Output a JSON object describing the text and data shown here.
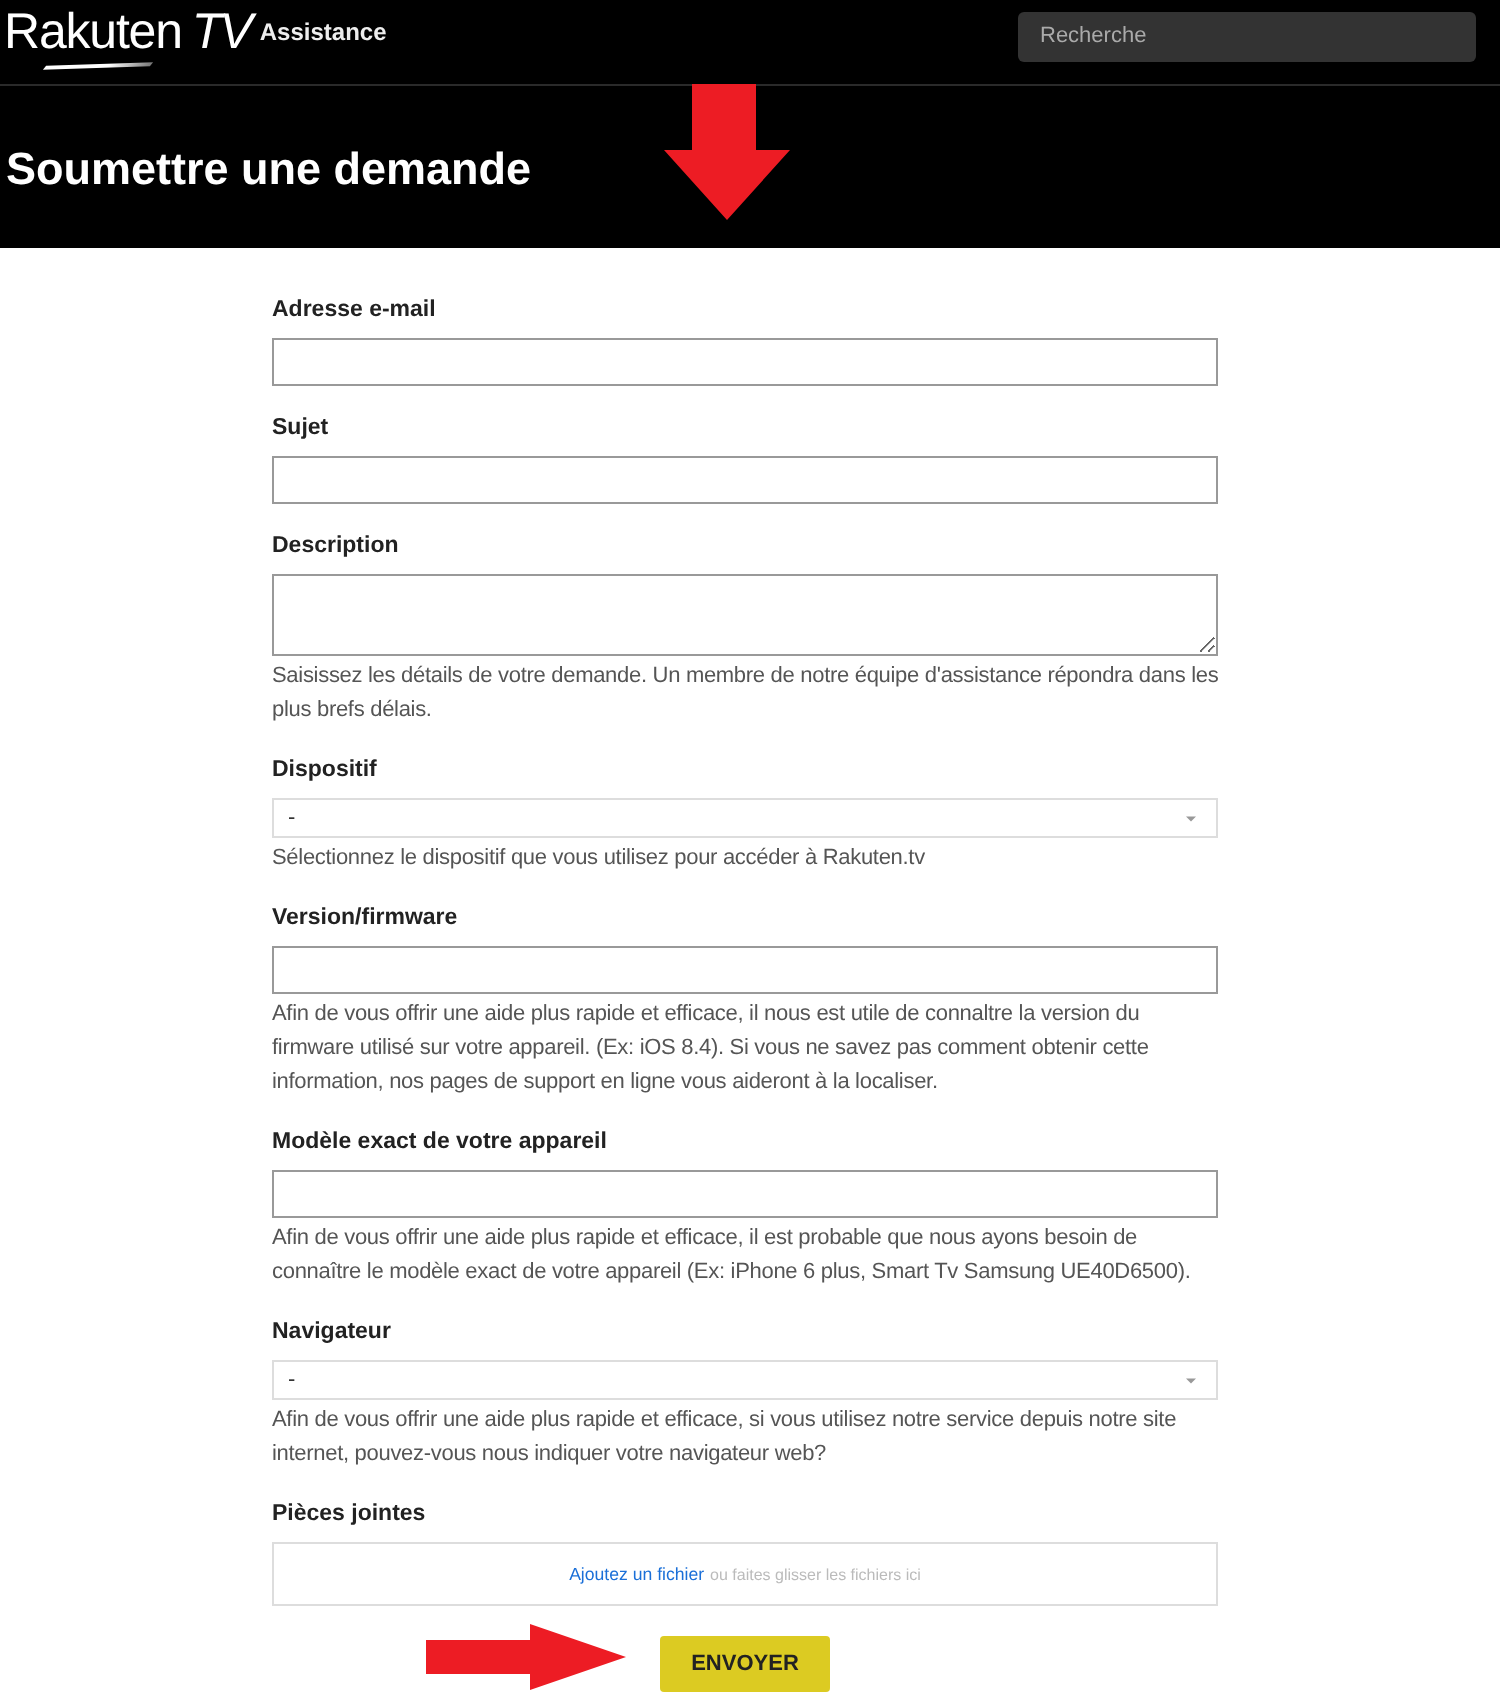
{
  "header": {
    "logo": {
      "wordmark": "Rakuten",
      "suffix": "TV"
    },
    "section_title": "Assistance",
    "search": {
      "placeholder": "Recherche"
    }
  },
  "hero": {
    "title": "Soumettre une demande",
    "marker": {
      "kind": "arrow_down"
    }
  },
  "fields": [
    {
      "kind": "text",
      "label": "Adresse e-mail"
    },
    {
      "kind": "text",
      "label": "Sujet"
    },
    {
      "kind": "textarea",
      "label": "Description",
      "hint": "Saisissez les détails de votre demande. Un membre de notre équipe d'assistance répondra dans les plus brefs délais."
    },
    {
      "kind": "select",
      "label": "Dispositif",
      "value": "-",
      "hint": "Sélectionnez le dispositif que vous utilisez pour accéder à Rakuten.tv"
    },
    {
      "kind": "text",
      "label": "Version/firmware",
      "hint": "Afin de vous offrir une aide plus rapide et efficace, il nous est utile de connaltre la version du firmware utilisé sur votre appareil. (Ex: iOS 8.4). Si vous ne savez pas comment obtenir cette information, nos pages de support en ligne vous aideront à la localiser."
    },
    {
      "kind": "text",
      "label": "Modèle exact de votre appareil",
      "hint": "Afin de vous offrir une aide plus rapide et efficace, il est probable que nous ayons besoin de connaître le modèle exact de votre appareil (Ex: iPhone 6 plus, Smart Tv Samsung UE40D6500)."
    },
    {
      "kind": "select",
      "label": "Navigateur",
      "value": "-",
      "hint": "Afin de vous offrir une aide plus rapide et efficace, si vous utilisez notre service depuis notre site internet, pouvez-vous nous indiquer votre navigateur web?"
    },
    {
      "kind": "attachments",
      "label": "Pièces jointes",
      "link": "Ajoutez un fichier",
      "text": "ou faites glisser les fichiers ici"
    }
  ],
  "submit": {
    "label": "ENVOYER",
    "marker": {
      "kind": "arrow_right"
    }
  }
}
